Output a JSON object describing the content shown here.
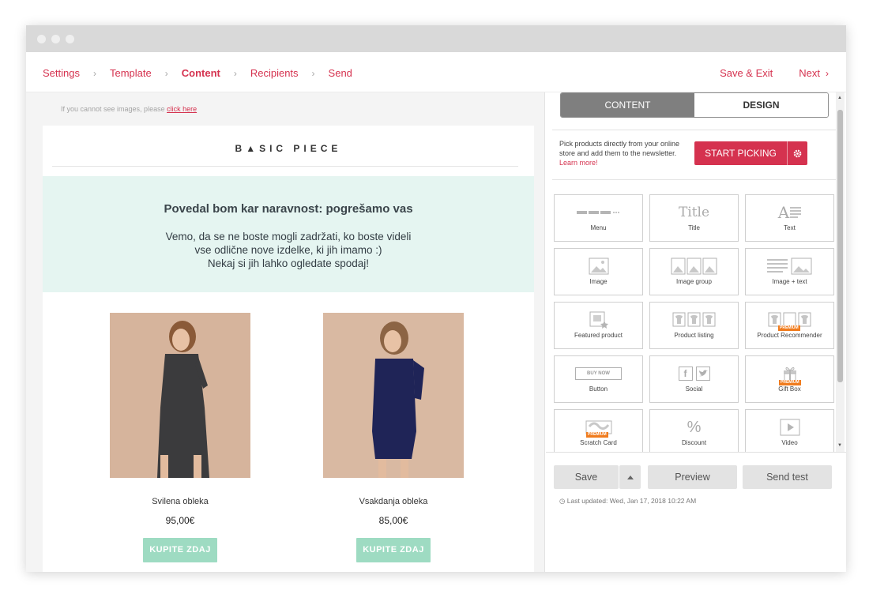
{
  "breadcrumb": [
    {
      "label": "Settings",
      "active": false
    },
    {
      "label": "Template",
      "active": false
    },
    {
      "label": "Content",
      "active": true
    },
    {
      "label": "Recipients",
      "active": false
    },
    {
      "label": "Send",
      "active": false
    }
  ],
  "nav": {
    "save_exit": "Save & Exit",
    "next": "Next",
    "next_chevron": "›",
    "sep_chevron": "›"
  },
  "preview": {
    "cant_see_text": "If you cannot see images, please ",
    "click_here": "click here",
    "logo": "B▲SIC PIECE",
    "hero_title": "Povedal bom kar naravnost: pogrešamo vas",
    "hero_lines": [
      "Vemo, da se ne boste mogli zadržati, ko boste videli",
      "vse odlične nove izdelke, ki jih imamo :)",
      "Nekaj si jih lahko ogledate spodaj!"
    ],
    "products": [
      {
        "name": "Svilena obleka",
        "price": "95,00€",
        "button": "KUPITE ZDAJ",
        "dress_color": "#3b3b3d"
      },
      {
        "name": "Vsakdanja obleka",
        "price": "85,00€",
        "button": "KUPITE ZDAJ",
        "dress_color": "#1f2457"
      }
    ]
  },
  "panel": {
    "tab_content": "CONTENT",
    "tab_design": "DESIGN",
    "pick_text": "Pick products directly from your online store and add them to the newsletter. ",
    "learn_more": "Learn more!",
    "start_picking": "START PICKING",
    "blocks": [
      {
        "label": "Menu",
        "icon": "menu-icon"
      },
      {
        "label": "Title",
        "icon": "title-icon",
        "icon_text": "Title"
      },
      {
        "label": "Text",
        "icon": "text-icon",
        "icon_text": "A"
      },
      {
        "label": "Image",
        "icon": "image-icon"
      },
      {
        "label": "Image group",
        "icon": "image-group-icon"
      },
      {
        "label": "Image + text",
        "icon": "image-text-icon"
      },
      {
        "label": "Featured product",
        "icon": "featured-product-icon"
      },
      {
        "label": "Product listing",
        "icon": "product-listing-icon"
      },
      {
        "label": "Product Recommender",
        "icon": "product-recommender-icon",
        "premium": "PREMIUM"
      },
      {
        "label": "Button",
        "icon": "button-icon",
        "icon_text": "BUY NOW"
      },
      {
        "label": "Social",
        "icon": "social-icon",
        "icon_text": "f"
      },
      {
        "label": "Gift Box",
        "icon": "gift-box-icon",
        "premium": "PREMIUM"
      },
      {
        "label": "Scratch Card",
        "icon": "scratch-card-icon",
        "premium": "PREMIUM"
      },
      {
        "label": "Discount",
        "icon": "discount-icon",
        "icon_text": "%"
      },
      {
        "label": "Video",
        "icon": "video-icon"
      }
    ],
    "save": "Save",
    "preview": "Preview",
    "send_test": "Send test",
    "last_updated_label": "Last updated:",
    "last_updated_value": "Wed, Jan 17, 2018 10:22 AM"
  },
  "colors": {
    "accent": "#d5324f",
    "mint": "#e5f5f1",
    "buy_button": "#9edbc2",
    "premium": "#f07c1e"
  }
}
